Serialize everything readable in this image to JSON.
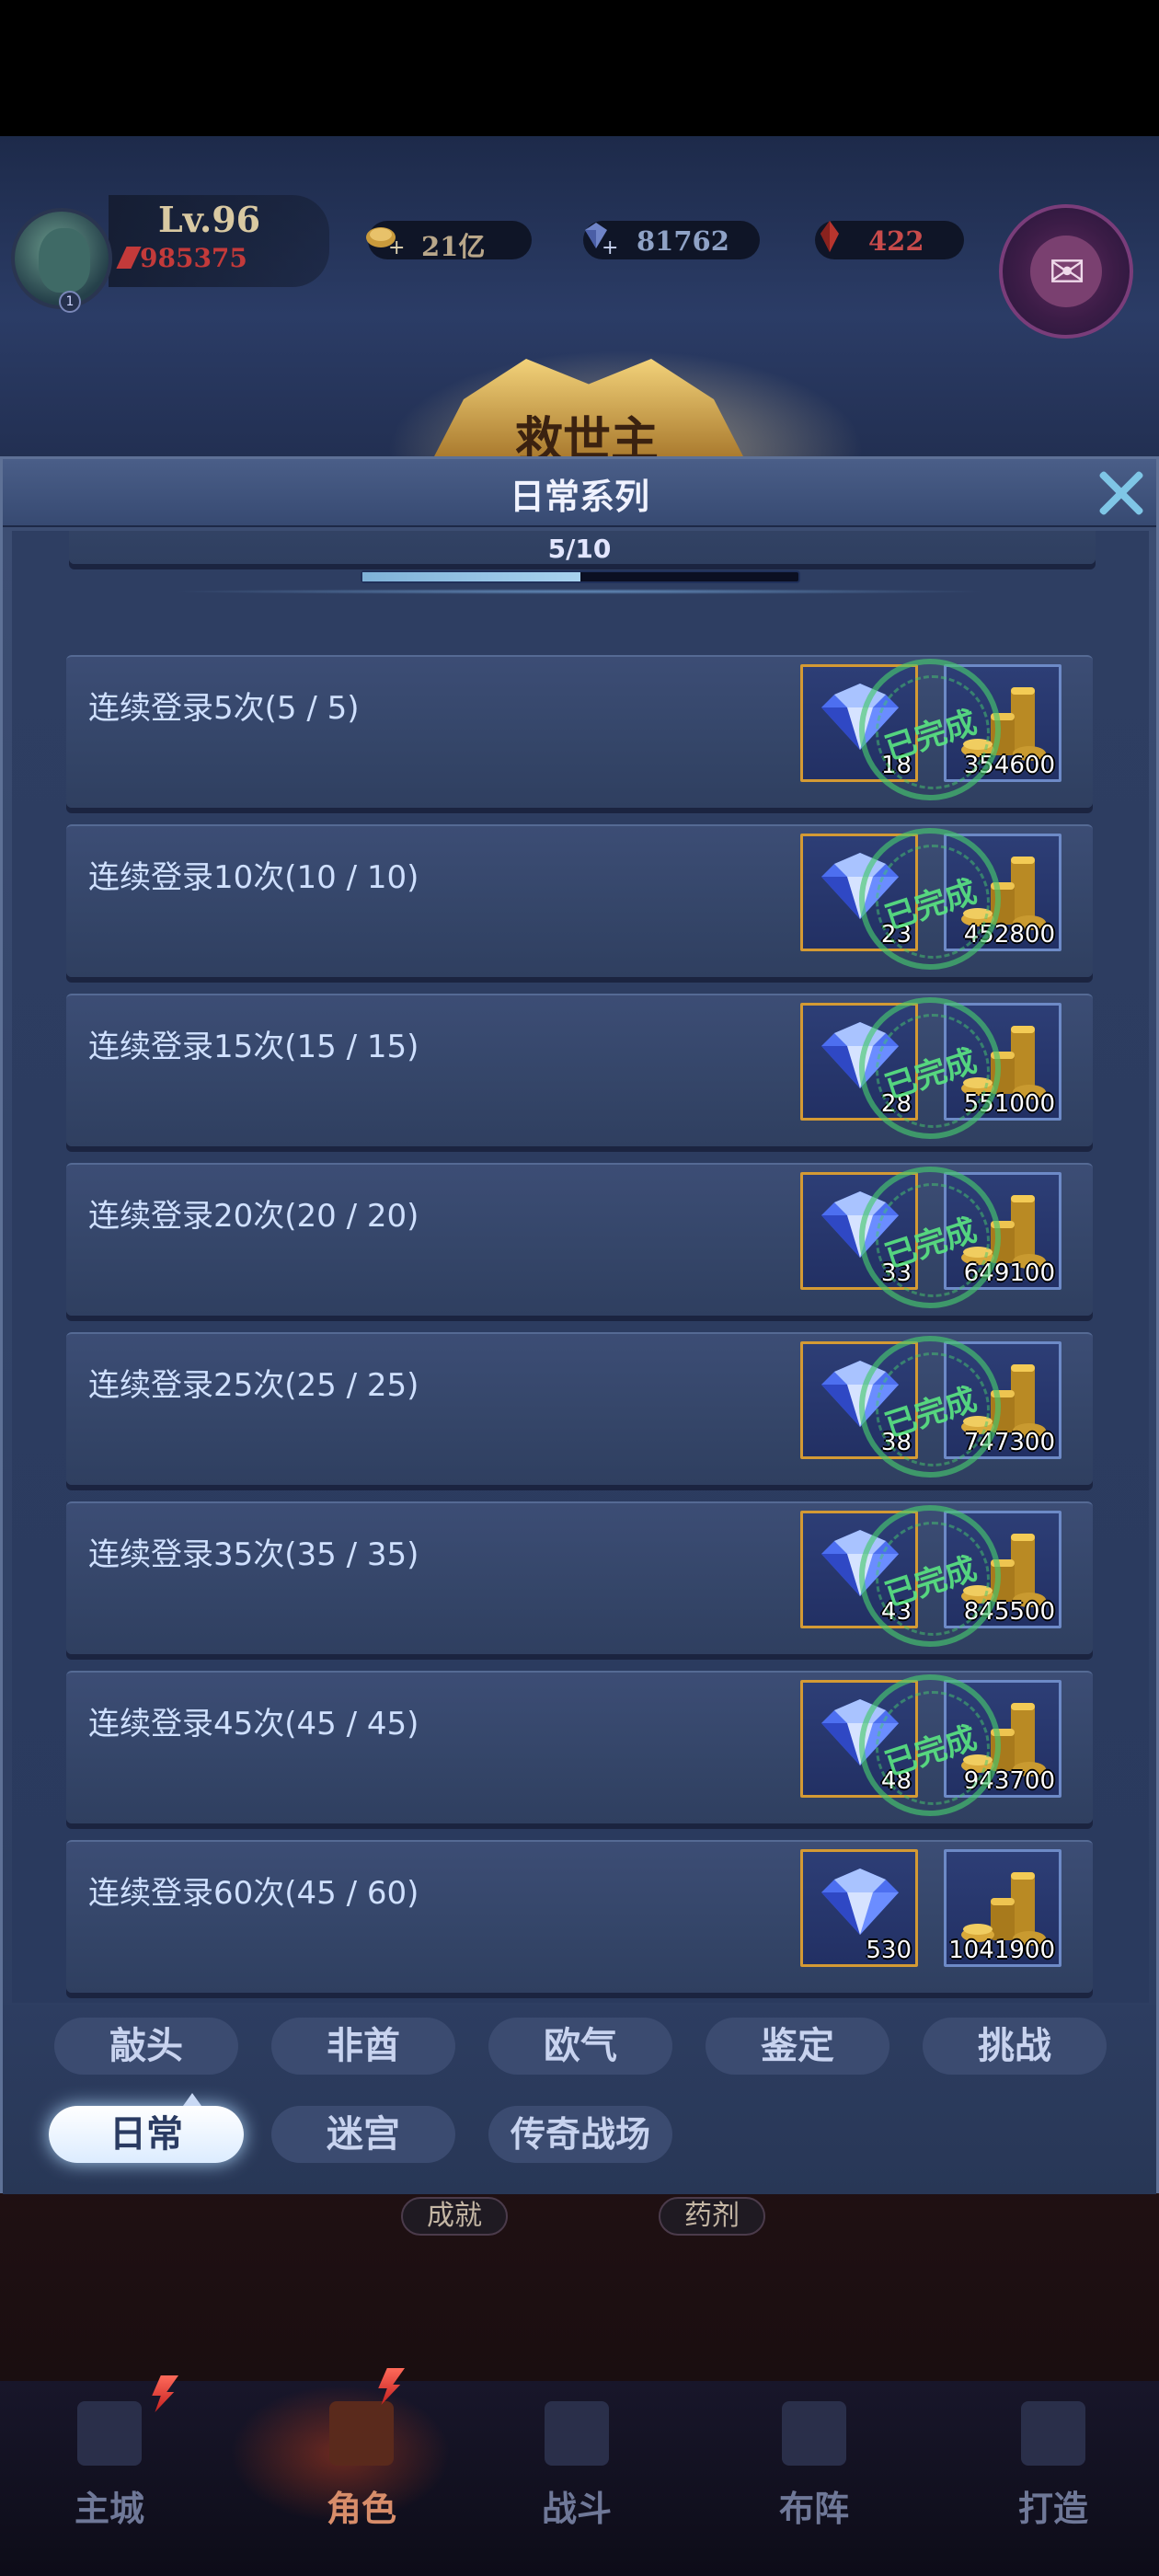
{
  "player": {
    "level": "Lv.96",
    "power": "985375",
    "avatar_level": "1"
  },
  "resources": {
    "gold": "21亿",
    "diamonds": "81762",
    "rubies": "422"
  },
  "banner_text": "救世主",
  "panel": {
    "title": "日常系列",
    "progress_text": "5/10",
    "progress_fraction": 0.5
  },
  "completed_stamp": "已完成",
  "tasks": [
    {
      "label": "连续登录5次(5 / 5)",
      "gem": "18",
      "coins": "354600",
      "done": true
    },
    {
      "label": "连续登录10次(10 / 10)",
      "gem": "23",
      "coins": "452800",
      "done": true
    },
    {
      "label": "连续登录15次(15 / 15)",
      "gem": "28",
      "coins": "551000",
      "done": true
    },
    {
      "label": "连续登录20次(20 / 20)",
      "gem": "33",
      "coins": "649100",
      "done": true
    },
    {
      "label": "连续登录25次(25 / 25)",
      "gem": "38",
      "coins": "747300",
      "done": true
    },
    {
      "label": "连续登录35次(35 / 35)",
      "gem": "43",
      "coins": "845500",
      "done": true
    },
    {
      "label": "连续登录45次(45 / 45)",
      "gem": "48",
      "coins": "943700",
      "done": true
    },
    {
      "label": "连续登录60次(45 / 60)",
      "gem": "530",
      "coins": "1041900",
      "done": false
    }
  ],
  "tabs_row1": [
    "敲头",
    "非酋",
    "欧气",
    "鉴定",
    "挑战"
  ],
  "tabs_row2": [
    "日常",
    "迷宫",
    "传奇战场"
  ],
  "mini_buttons": [
    "成就",
    "药剂"
  ],
  "bottom_nav": [
    "主城",
    "角色",
    "战斗",
    "布阵",
    "打造"
  ],
  "colors": {
    "panel": "#34456a",
    "gold_border": "#d49a34",
    "blue_border": "#6d8ac7",
    "stamp_green": "#46c86e"
  }
}
